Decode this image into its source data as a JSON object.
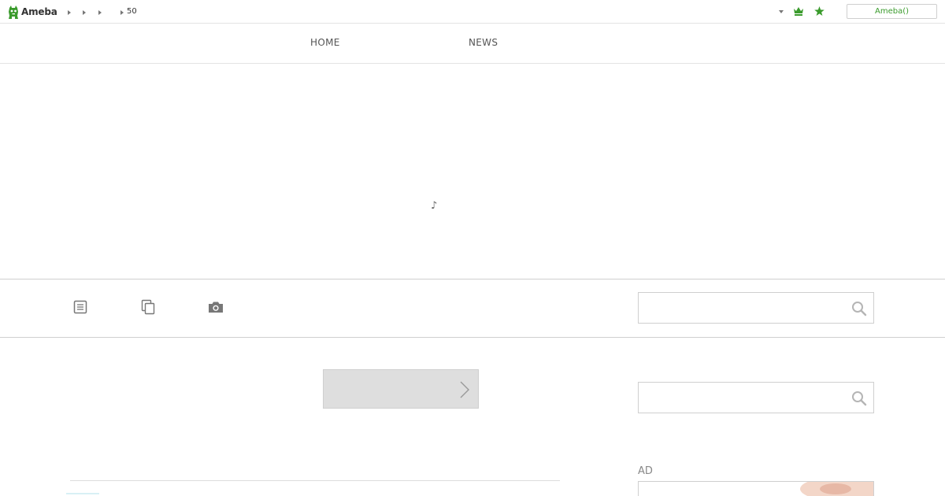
{
  "topbar": {
    "logo_text": "Ameba",
    "breadcrumb_count": "50",
    "login_label": "Ameba()"
  },
  "nav": {
    "items": [
      {
        "label": "HOME"
      },
      {
        "label": "NEWS"
      }
    ]
  },
  "header": {
    "note_glyph": "♪"
  },
  "toolbar": {
    "icons": [
      "document-icon",
      "copy-pages-icon",
      "camera-icon"
    ]
  },
  "search": {
    "top_placeholder": "",
    "side_placeholder": ""
  },
  "sidebar": {
    "ad_label": "AD"
  },
  "colors": {
    "brand_green": "#3a9b2c",
    "border": "#cfcfcf",
    "button_gray": "#dedede"
  }
}
